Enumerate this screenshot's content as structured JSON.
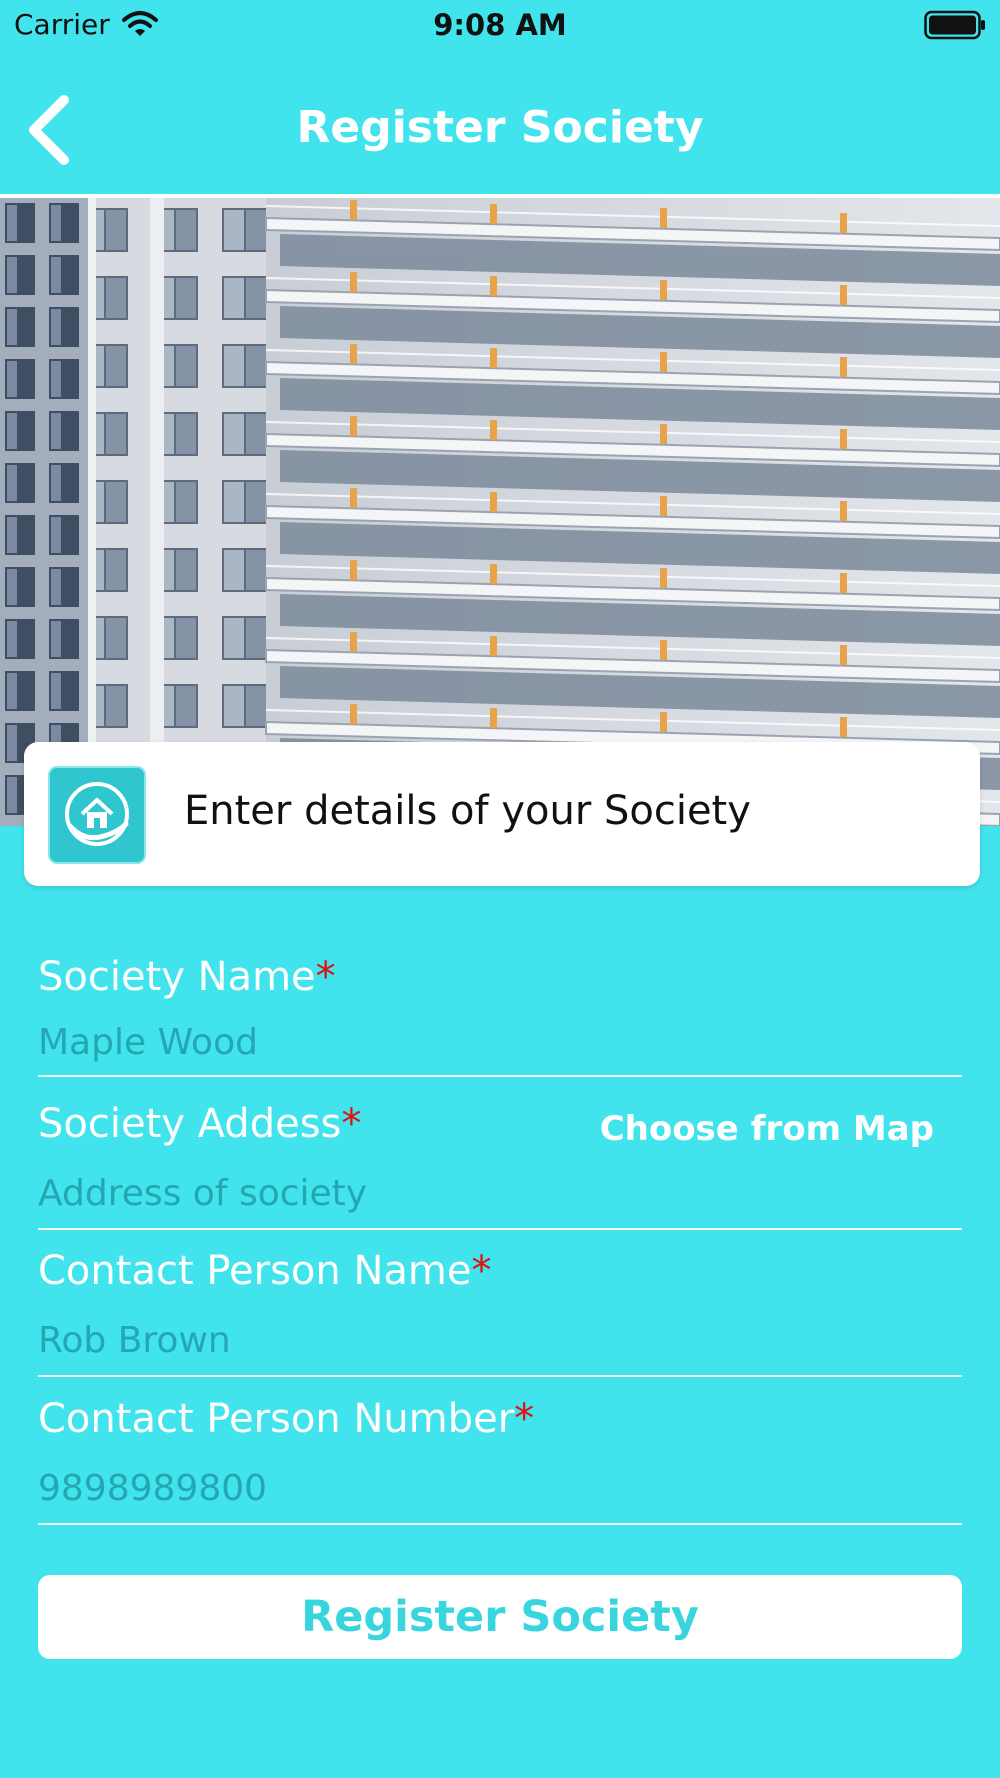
{
  "status_bar": {
    "carrier": "Carrier",
    "time": "9:08 AM",
    "icons": [
      "wifi-icon",
      "battery-icon"
    ]
  },
  "nav": {
    "title": "Register Society",
    "back_icon": "chevron-left-icon"
  },
  "colors": {
    "background": "#41e3ec",
    "accent": "#39d5df",
    "required": "#e01111",
    "card": "#ffffff"
  },
  "hero": {
    "image": "apartment-building-photo"
  },
  "card": {
    "icon": "society-home-hand-icon",
    "text": "Enter details of your Society"
  },
  "form": {
    "fields": [
      {
        "label": "Society Name",
        "required_mark": "*",
        "placeholder": "Maple Wood"
      },
      {
        "label": "Society Addess",
        "required_mark": "*",
        "placeholder": "Address of society",
        "action": "Choose from Map"
      },
      {
        "label": "Contact Person Name",
        "required_mark": "*",
        "placeholder": "Rob Brown"
      },
      {
        "label": "Contact Person Number",
        "required_mark": "*",
        "placeholder": "9898989800"
      }
    ],
    "submit_label": "Register Society"
  }
}
